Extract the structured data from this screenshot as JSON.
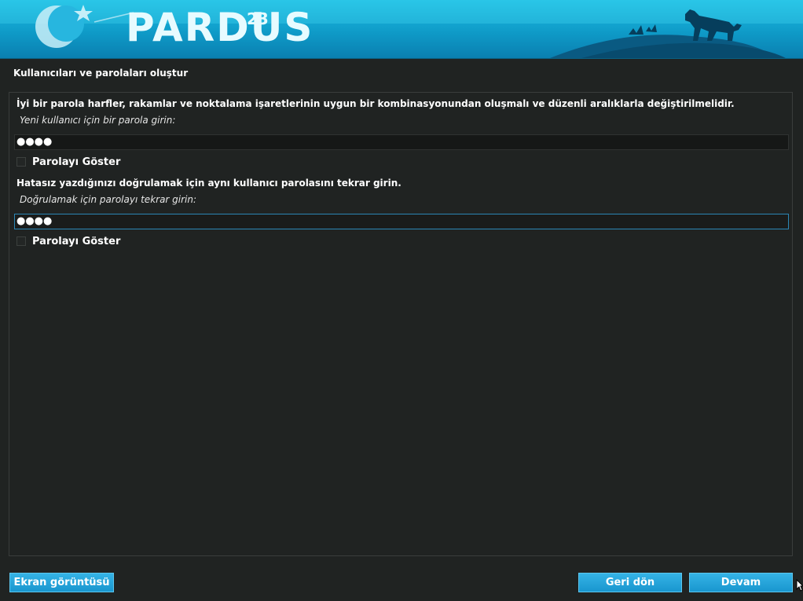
{
  "banner": {
    "logo_text": "PARDUS",
    "logo_version": "23"
  },
  "page": {
    "title": "Kullanıcıları ve parolaları oluştur"
  },
  "password_section": {
    "instruction": "İyi bir parola harfler, rakamlar ve noktalama işaretlerinin uygun bir kombinasyonundan oluşmalı ve düzenli aralıklarla değiştirilmelidir.",
    "prompt": "Yeni kullanıcı için bir parola girin:",
    "value": "●●●●",
    "show_password_label": "Parolayı Göster"
  },
  "confirm_section": {
    "instruction": "Hatasız yazdığınızı doğrulamak için aynı kullanıcı parolasını tekrar girin.",
    "prompt": "Doğrulamak için parolayı tekrar girin:",
    "value": "●●●●",
    "show_password_label": "Parolayı Göster"
  },
  "footer": {
    "screenshot_label": "Ekran görüntüsü",
    "back_label": "Geri dön",
    "continue_label": "Devam"
  },
  "colors": {
    "banner_top": "#1fc0e4",
    "banner_bottom": "#0a7fb0",
    "background": "#202322",
    "button": "#1996cf",
    "focus_border": "#2b86b5"
  },
  "icons": [
    "crescent-star-icon",
    "leopard-silhouette-icon",
    "mouse-cursor-icon"
  ]
}
